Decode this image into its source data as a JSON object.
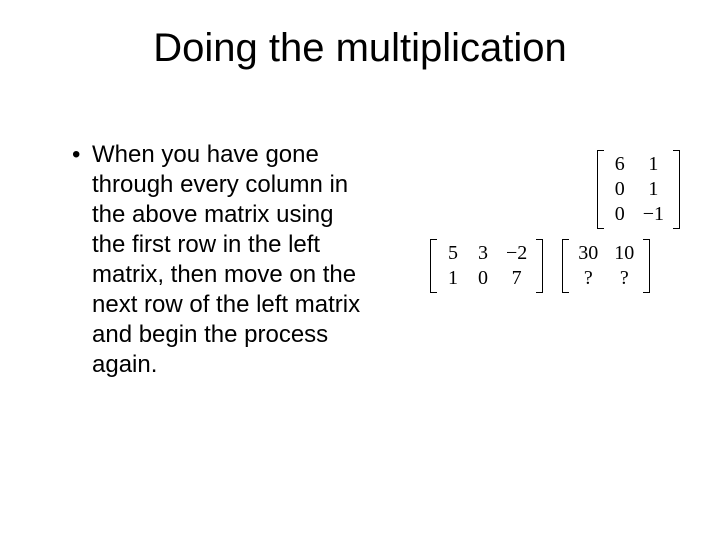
{
  "title": "Doing the multiplication",
  "bullet": {
    "marker": "•",
    "text": "When you have gone through every column in the above matrix using the first row in the left matrix, then move on the next row of the left matrix and begin the process again."
  },
  "matrices": {
    "top": {
      "r0c0": "6",
      "r0c1": "1",
      "r1c0": "0",
      "r1c1": "1",
      "r2c0": "0",
      "r2c1": "−1"
    },
    "left": {
      "r0c0": "5",
      "r0c1": "3",
      "r0c2": "−2",
      "r1c0": "1",
      "r1c1": "0",
      "r1c2": "7"
    },
    "result": {
      "r0c0": "30",
      "r0c1": "10",
      "r1c0": "?",
      "r1c1": "?"
    }
  }
}
